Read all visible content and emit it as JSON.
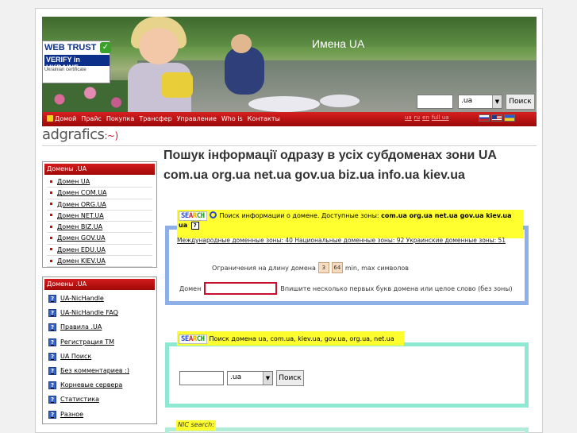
{
  "header": {
    "site_title": "Имена UA",
    "trust_badge": {
      "line1": "WEB TRUST",
      "line2": "VERIFY in UKRAINE",
      "line3": "Ukrainian certificate"
    },
    "search": {
      "input_value": "",
      "zone_selected": ".ua",
      "button_label": "Поиск"
    }
  },
  "nav": {
    "items": [
      "Домой",
      "Прайс",
      "Покупка",
      "Трансфер",
      "Управление",
      "Who is",
      "Контакты"
    ],
    "lang_links": [
      "ua",
      "ru",
      "en",
      "full ua"
    ],
    "flags": [
      "ru",
      "us",
      "ua"
    ]
  },
  "logo": {
    "text": "adgrafics",
    "smile": ":~)"
  },
  "sidebar": {
    "box1": {
      "title": "Домены .UA",
      "items": [
        "Домен UA",
        "Домен COM.UA",
        "Домен ORG.UA",
        "Домен NET.UA",
        "Домен BIZ.UA",
        "Домен GOV.UA",
        "Домен EDU.UA",
        "Домен KIEV.UA"
      ]
    },
    "box2": {
      "title": "Домены .UA",
      "items": [
        "UA-NicHandle",
        "UA-NicHandle FAQ",
        "Правила .UA",
        "Регистрация TM",
        "UA Поиск",
        "Без комментариев :)",
        "Корневые сервера",
        "Статистика",
        "Разное"
      ]
    }
  },
  "main": {
    "heading": "Пошук інформації одразу в усіх субдоменах зони UA",
    "heading_zones": "com.ua org.ua net.ua gov.ua biz.ua info.ua kiev.ua",
    "search_logo": [
      "SE",
      "A",
      "R",
      "CH"
    ],
    "section1": {
      "intro": "Поиск информации о домене. Доступные зоны:",
      "zones": "com.ua org.ua net.ua gov.ua kiev.ua ua",
      "zones_line": "Международные доменные зоны: 40  Национальные доменные зоны: 92  Украинские доменные зоны: 51",
      "limits_label": "Ограничения на длину домена",
      "min": "3",
      "max": "64",
      "limits_suffix": "min, max символов",
      "domain_label": "Домен",
      "domain_value": "",
      "domain_hint": "Впишите несколько первых букв домена или целое слово (без зоны)"
    },
    "section2": {
      "intro": "Поиск домена ua, com.ua, kiev.ua, gov.ua, org.ua, net.ua",
      "input_value": "",
      "zone_selected": ".ua",
      "button_label": "Поиск"
    },
    "section3": {
      "title": "NIC search:"
    }
  }
}
